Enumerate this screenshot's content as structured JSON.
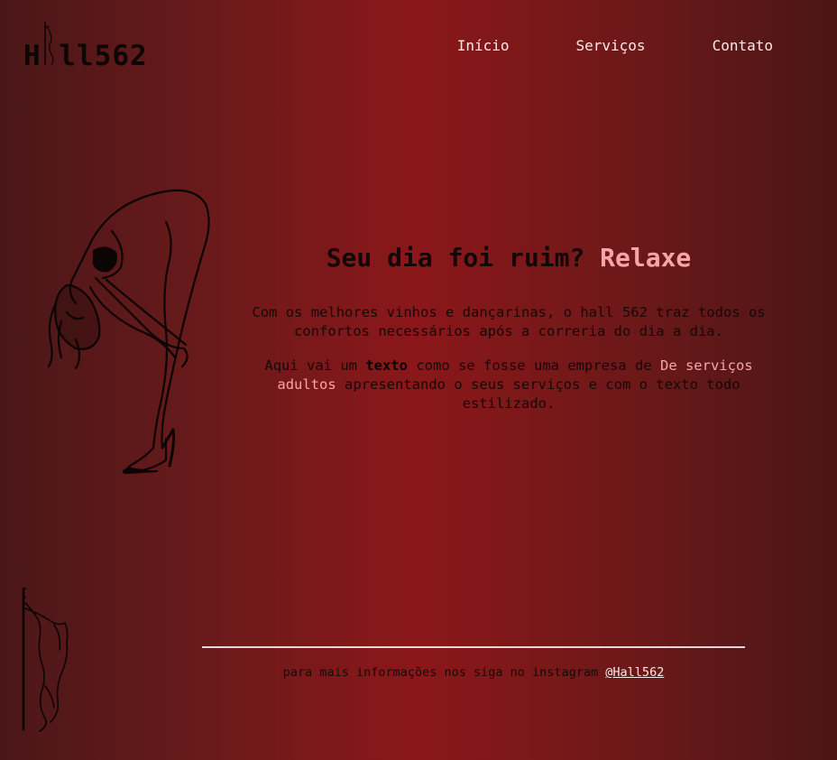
{
  "header": {
    "logo_text": "H  ll562",
    "nav": [
      {
        "label": "Início"
      },
      {
        "label": "Serviços"
      },
      {
        "label": "Contato"
      }
    ]
  },
  "hero": {
    "title_main": "Seu dia foi ruim? ",
    "title_accent": "Relaxe",
    "paragraph1": "Com os melhores vinhos e dançarinas, o hall 562 traz todos os confortos necessários após a correria do dia a dia.",
    "paragraph2_part1": "Aqui vai um ",
    "paragraph2_bold": "texto",
    "paragraph2_part2": " como se fosse uma empresa de ",
    "paragraph2_accent": "De serviços adultos",
    "paragraph2_part3": " apresentando o seus serviços e com o texto todo estilizado."
  },
  "footer": {
    "text": "para mais informações nos siga no instagram ",
    "instagram_handle": "@Hall562"
  },
  "colors": {
    "accent": "#f8a5aa",
    "background_center": "#8b1719",
    "background_edge": "#4a1718",
    "text_dark": "#130606",
    "text_light": "#fbeaea"
  },
  "icons": {
    "logo_figure": "pole-dancer-silhouette",
    "hero_image": "bending-dancer-line-art",
    "footer_image": "pole-dancer-line-art"
  }
}
